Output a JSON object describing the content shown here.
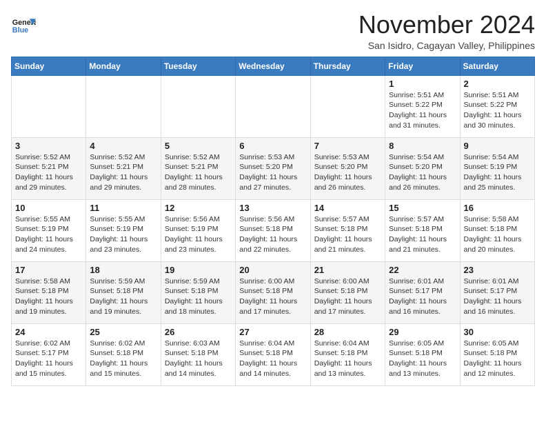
{
  "header": {
    "logo_line1": "General",
    "logo_line2": "Blue",
    "month_title": "November 2024",
    "subtitle": "San Isidro, Cagayan Valley, Philippines"
  },
  "weekdays": [
    "Sunday",
    "Monday",
    "Tuesday",
    "Wednesday",
    "Thursday",
    "Friday",
    "Saturday"
  ],
  "weeks": [
    [
      {
        "day": "",
        "info": ""
      },
      {
        "day": "",
        "info": ""
      },
      {
        "day": "",
        "info": ""
      },
      {
        "day": "",
        "info": ""
      },
      {
        "day": "",
        "info": ""
      },
      {
        "day": "1",
        "info": "Sunrise: 5:51 AM\nSunset: 5:22 PM\nDaylight: 11 hours\nand 31 minutes."
      },
      {
        "day": "2",
        "info": "Sunrise: 5:51 AM\nSunset: 5:22 PM\nDaylight: 11 hours\nand 30 minutes."
      }
    ],
    [
      {
        "day": "3",
        "info": "Sunrise: 5:52 AM\nSunset: 5:21 PM\nDaylight: 11 hours\nand 29 minutes."
      },
      {
        "day": "4",
        "info": "Sunrise: 5:52 AM\nSunset: 5:21 PM\nDaylight: 11 hours\nand 29 minutes."
      },
      {
        "day": "5",
        "info": "Sunrise: 5:52 AM\nSunset: 5:21 PM\nDaylight: 11 hours\nand 28 minutes."
      },
      {
        "day": "6",
        "info": "Sunrise: 5:53 AM\nSunset: 5:20 PM\nDaylight: 11 hours\nand 27 minutes."
      },
      {
        "day": "7",
        "info": "Sunrise: 5:53 AM\nSunset: 5:20 PM\nDaylight: 11 hours\nand 26 minutes."
      },
      {
        "day": "8",
        "info": "Sunrise: 5:54 AM\nSunset: 5:20 PM\nDaylight: 11 hours\nand 26 minutes."
      },
      {
        "day": "9",
        "info": "Sunrise: 5:54 AM\nSunset: 5:19 PM\nDaylight: 11 hours\nand 25 minutes."
      }
    ],
    [
      {
        "day": "10",
        "info": "Sunrise: 5:55 AM\nSunset: 5:19 PM\nDaylight: 11 hours\nand 24 minutes."
      },
      {
        "day": "11",
        "info": "Sunrise: 5:55 AM\nSunset: 5:19 PM\nDaylight: 11 hours\nand 23 minutes."
      },
      {
        "day": "12",
        "info": "Sunrise: 5:56 AM\nSunset: 5:19 PM\nDaylight: 11 hours\nand 23 minutes."
      },
      {
        "day": "13",
        "info": "Sunrise: 5:56 AM\nSunset: 5:18 PM\nDaylight: 11 hours\nand 22 minutes."
      },
      {
        "day": "14",
        "info": "Sunrise: 5:57 AM\nSunset: 5:18 PM\nDaylight: 11 hours\nand 21 minutes."
      },
      {
        "day": "15",
        "info": "Sunrise: 5:57 AM\nSunset: 5:18 PM\nDaylight: 11 hours\nand 21 minutes."
      },
      {
        "day": "16",
        "info": "Sunrise: 5:58 AM\nSunset: 5:18 PM\nDaylight: 11 hours\nand 20 minutes."
      }
    ],
    [
      {
        "day": "17",
        "info": "Sunrise: 5:58 AM\nSunset: 5:18 PM\nDaylight: 11 hours\nand 19 minutes."
      },
      {
        "day": "18",
        "info": "Sunrise: 5:59 AM\nSunset: 5:18 PM\nDaylight: 11 hours\nand 19 minutes."
      },
      {
        "day": "19",
        "info": "Sunrise: 5:59 AM\nSunset: 5:18 PM\nDaylight: 11 hours\nand 18 minutes."
      },
      {
        "day": "20",
        "info": "Sunrise: 6:00 AM\nSunset: 5:18 PM\nDaylight: 11 hours\nand 17 minutes."
      },
      {
        "day": "21",
        "info": "Sunrise: 6:00 AM\nSunset: 5:18 PM\nDaylight: 11 hours\nand 17 minutes."
      },
      {
        "day": "22",
        "info": "Sunrise: 6:01 AM\nSunset: 5:17 PM\nDaylight: 11 hours\nand 16 minutes."
      },
      {
        "day": "23",
        "info": "Sunrise: 6:01 AM\nSunset: 5:17 PM\nDaylight: 11 hours\nand 16 minutes."
      }
    ],
    [
      {
        "day": "24",
        "info": "Sunrise: 6:02 AM\nSunset: 5:17 PM\nDaylight: 11 hours\nand 15 minutes."
      },
      {
        "day": "25",
        "info": "Sunrise: 6:02 AM\nSunset: 5:18 PM\nDaylight: 11 hours\nand 15 minutes."
      },
      {
        "day": "26",
        "info": "Sunrise: 6:03 AM\nSunset: 5:18 PM\nDaylight: 11 hours\nand 14 minutes."
      },
      {
        "day": "27",
        "info": "Sunrise: 6:04 AM\nSunset: 5:18 PM\nDaylight: 11 hours\nand 14 minutes."
      },
      {
        "day": "28",
        "info": "Sunrise: 6:04 AM\nSunset: 5:18 PM\nDaylight: 11 hours\nand 13 minutes."
      },
      {
        "day": "29",
        "info": "Sunrise: 6:05 AM\nSunset: 5:18 PM\nDaylight: 11 hours\nand 13 minutes."
      },
      {
        "day": "30",
        "info": "Sunrise: 6:05 AM\nSunset: 5:18 PM\nDaylight: 11 hours\nand 12 minutes."
      }
    ]
  ]
}
